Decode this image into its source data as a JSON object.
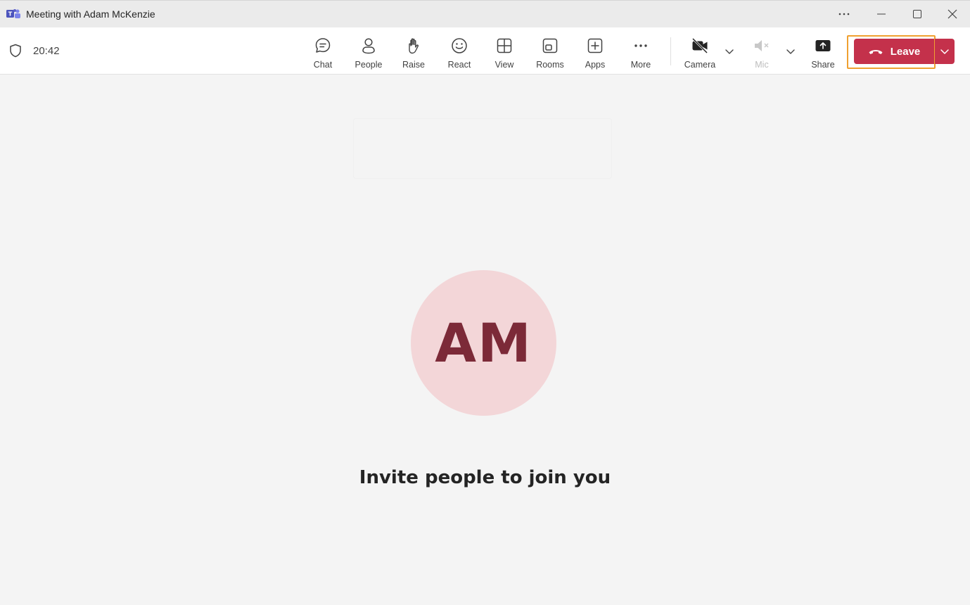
{
  "window": {
    "title": "Meeting with Adam McKenzie"
  },
  "toolbar": {
    "timer": "20:42",
    "buttons": {
      "chat": "Chat",
      "people": "People",
      "raise": "Raise",
      "react": "React",
      "view": "View",
      "rooms": "Rooms",
      "apps": "Apps",
      "more": "More",
      "camera": "Camera",
      "mic": "Mic",
      "share": "Share"
    },
    "leave_label": "Leave"
  },
  "stage": {
    "avatar_initials": "AM",
    "invite_text": "Invite people to join you"
  },
  "colors": {
    "leave_red": "#c4314b",
    "highlight_orange": "#f0a030",
    "avatar_bg": "#f3d6d8",
    "avatar_fg": "#7c2a38",
    "teams_purple": "#5b5fc7"
  }
}
